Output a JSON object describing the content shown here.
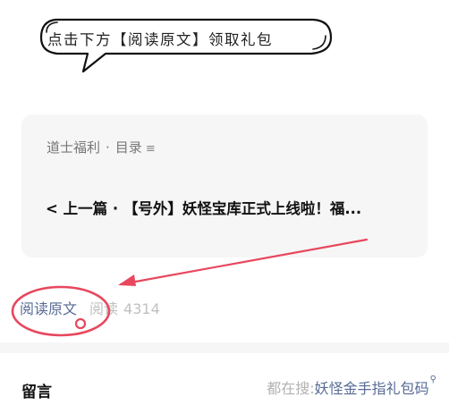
{
  "callout": {
    "text": "点击下方【阅读原文】领取礼包"
  },
  "album": {
    "name": "道士福利",
    "separator": "·",
    "menu_label": "目录",
    "menu_icon": "list-icon",
    "prev_article": "< 上一篇 · 【号外】妖怪宝库正式上线啦！福..."
  },
  "article_footer": {
    "read_original": "阅读原文",
    "reads_label": "阅读",
    "reads_count": "4314"
  },
  "comments": {
    "title": "留言",
    "search_prefix": "都在搜: ",
    "search_term": "妖怪金手指礼包码",
    "search_icon": "search-icon"
  },
  "colors": {
    "link": "#576b95",
    "annotation": "#e8475e",
    "card_background": "#f6f6f6"
  }
}
